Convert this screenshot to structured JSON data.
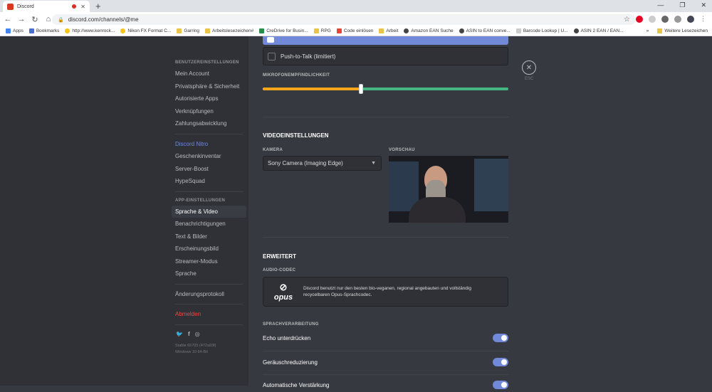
{
  "browser": {
    "tab_title": "Discord",
    "url": "discord.com/channels/@me",
    "bookmarks": [
      "Apps",
      "Bookmarks",
      "http://www.kenrock...",
      "Nikon FX Format C...",
      "Garring",
      "Arbeitslesezeichen#",
      "CreDrive for Busin...",
      "RPG",
      "Code einlösen",
      "Arbeit",
      "Amazon EAN Suche",
      "ASIN to EAN conve...",
      "Barcode Lookup | U...",
      "ASIN 2 EAN / EAN..."
    ],
    "more": "»",
    "other_bookmarks": "Weitere Lesezeichen",
    "colors": {
      "tabbar": "#dee1e6"
    }
  },
  "sidebar": {
    "user_header": "BENUTZEREINSTELLUNGEN",
    "user_items": [
      "Mein Account",
      "Privatsphäre & Sicherheit",
      "Autorisierte Apps",
      "Verknüpfungen",
      "Zahlungsabwicklung"
    ],
    "nitro_items": [
      "Discord Nitro",
      "Geschenkinventar",
      "Server-Boost",
      "HypeSquad"
    ],
    "app_header": "APP-EINSTELLUNGEN",
    "app_items": [
      "Sprache & Video",
      "Benachrichtigungen",
      "Text & Bilder",
      "Erscheinungsbild",
      "Streamer-Modus",
      "Sprache"
    ],
    "changelog": "Änderungsprotokoll",
    "logout": "Abmelden",
    "version_line1": "Stable 65705 (472a93f)",
    "version_line2": "Windows 10 64-Bit"
  },
  "content": {
    "push_to_talk": "Push-to-Talk (limitiert)",
    "mic_sensitivity_label": "MIKROFONEMPFINDLICHKEIT",
    "mic_sensitivity_fraction": 0.4,
    "video_heading": "VIDEOEINSTELLUNGEN",
    "camera_label": "KAMERA",
    "camera_value": "Sony Camera (Imaging Edge)",
    "preview_label": "VORSCHAU",
    "advanced_heading": "ERWEITERT",
    "codec_label": "AUDIO-CODEC",
    "codec_logo": "opus",
    "codec_text": "Discord benutzt nur den besten bio-veganen, regional angebauten und vollständig recycelbaren Opus-Sprachcodec.",
    "processing_label": "SPRACHVERARBEITUNG",
    "toggles": [
      "Echo unterdrücken",
      "Geräuschreduzierung",
      "Automatische Verstärkung"
    ],
    "esc_label": "ESC"
  }
}
